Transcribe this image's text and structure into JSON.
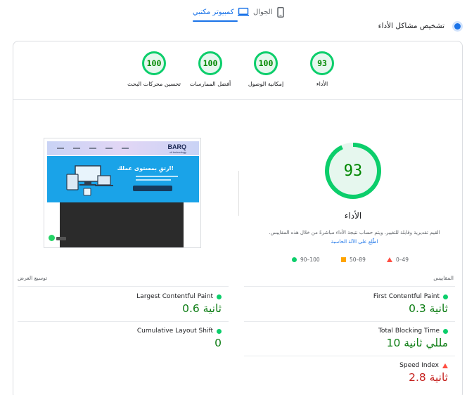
{
  "tabs": [
    {
      "label": "الجوال",
      "icon": "mobile-phone-icon",
      "active": false
    },
    {
      "label": "كمبيوتر مكتبي",
      "icon": "desktop-monitor-icon",
      "active": true
    }
  ],
  "diagnostics_title": "تشخيص مشاكل الأداء",
  "categories": [
    {
      "score": "93",
      "label": "الأداء"
    },
    {
      "score": "100",
      "label": "إمكانية الوصول"
    },
    {
      "score": "100",
      "label": "أفضل الممارسات"
    },
    {
      "score": "100",
      "label": "تحسين محركات البحث"
    }
  ],
  "screenshot": {
    "brand": "BARQ",
    "brand_sub": "of technology",
    "hero_text": "ارتقِ بمستوى عملك!"
  },
  "performance": {
    "score": 93,
    "score_text": "93",
    "label": "الأداء",
    "description": "القيم تقديرية وقابلة للتغيير. ويتم حساب نتيجة الأداء مباشرةً من خلال هذه المقاييس.",
    "link_text": "اطّلِع على الآلة الحاسبة"
  },
  "legend": {
    "fail": "0–49",
    "average": "50–89",
    "pass": "90–100"
  },
  "metrics_label": "المقاييس",
  "expand_view": "توسيع العرض",
  "metrics": {
    "fcp": {
      "name": "First Contentful Paint",
      "value": "0.3 ثانية",
      "status": "pass"
    },
    "tbt": {
      "name": "Total Blocking Time",
      "value": "10 مللي ثانية",
      "status": "pass"
    },
    "si": {
      "name": "Speed Index",
      "value": "2.8 ثانية",
      "status": "fail"
    },
    "lcp": {
      "name": "Largest Contentful Paint",
      "value": "0.6 ثانية",
      "status": "pass"
    },
    "cls": {
      "name": "Cumulative Layout Shift",
      "value": "0",
      "status": "pass"
    }
  },
  "colors": {
    "accent": "#1a73e8",
    "pass": "#0cce6b",
    "pass_text": "#008800",
    "average": "#ffa400",
    "fail": "#ff4e42"
  }
}
